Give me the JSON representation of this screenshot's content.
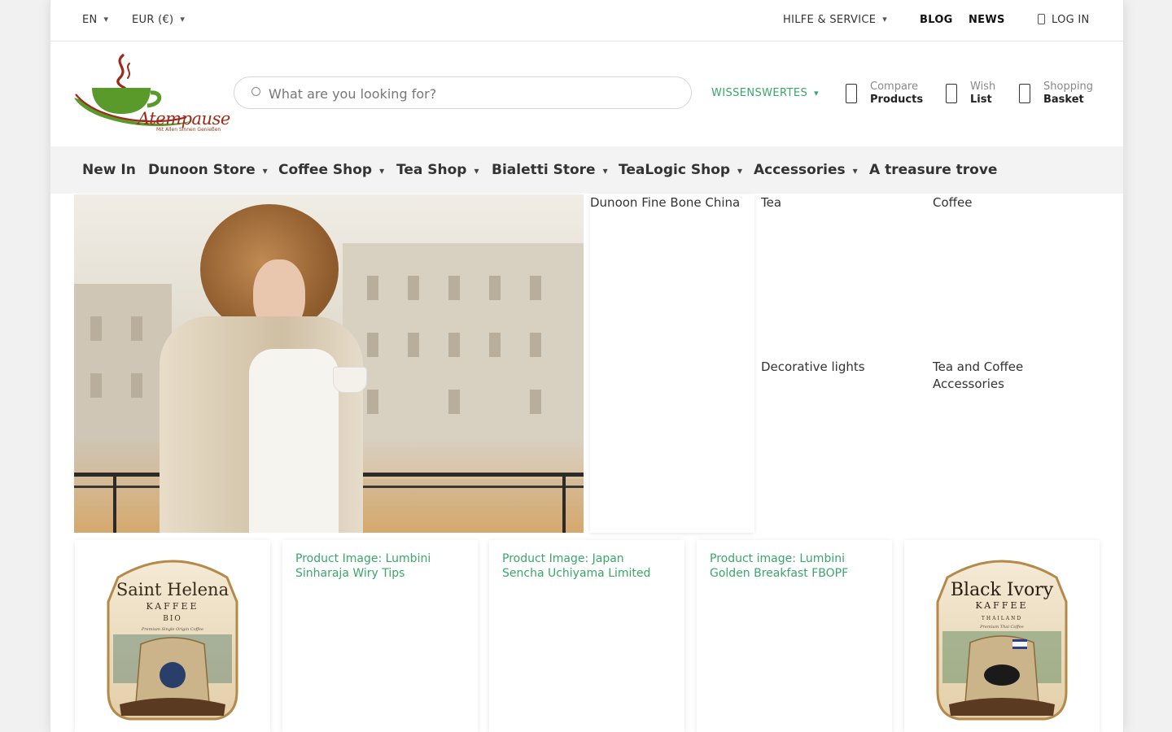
{
  "topbar": {
    "language": "EN",
    "currency": "EUR (€)",
    "help": "HILFE & SERVICE",
    "blog": "BLOG",
    "news": "NEWS",
    "login": "LOG IN"
  },
  "logo": {
    "name": "Atempause",
    "tagline": "Mit Allen Sinnen Genießen"
  },
  "search": {
    "placeholder": "What are you looking for?"
  },
  "header": {
    "wissenswertes": "WISSENSWERTES",
    "compare": {
      "line1": "Compare",
      "line2": "Products"
    },
    "wishlist": {
      "line1": "Wish",
      "line2": "List"
    },
    "basket": {
      "line1": "Shopping",
      "line2": "Basket"
    }
  },
  "nav": {
    "items": [
      {
        "label": "New In",
        "dropdown": false
      },
      {
        "label": "Dunoon Store",
        "dropdown": true
      },
      {
        "label": "Coffee Shop",
        "dropdown": true
      },
      {
        "label": "Tea Shop",
        "dropdown": true
      },
      {
        "label": "Bialetti Store",
        "dropdown": true
      },
      {
        "label": "TeaLogic Shop",
        "dropdown": true
      },
      {
        "label": "Accessories",
        "dropdown": true
      },
      {
        "label": "A treasure trove",
        "dropdown": false
      }
    ]
  },
  "tiles": {
    "dunoon": "Dunoon Fine Bone China",
    "tea": "Tea",
    "coffee": "Coffee",
    "lights": "Decorative lights",
    "accessories": "Tea and Coffee Accessories"
  },
  "products": [
    {
      "brand": "Saint Helena",
      "sub": "KAFFEE",
      "tag": "BIO",
      "caption": "Premium Single Origin Coffee"
    },
    {
      "alt": "Product Image: Lumbini Sinharaja Wiry Tips"
    },
    {
      "alt": "Product Image: Japan Sencha Uchiyama Limited"
    },
    {
      "alt": "Product image: Lumbini Golden Breakfast FBOPF"
    },
    {
      "brand": "Black Ivory",
      "sub": "KAFFEE",
      "tag": "THAILAND",
      "caption": "Premium Thai Coffee"
    }
  ],
  "icons": {
    "chevron": "chevron-down-icon",
    "search": "search-icon",
    "compare": "compare-icon",
    "wishlist": "heart-icon",
    "basket": "basket-icon",
    "user": "user-icon"
  },
  "colors": {
    "accent": "#3aa66b",
    "logo_red": "#9c2a1a",
    "logo_green": "#5a9a2a"
  }
}
